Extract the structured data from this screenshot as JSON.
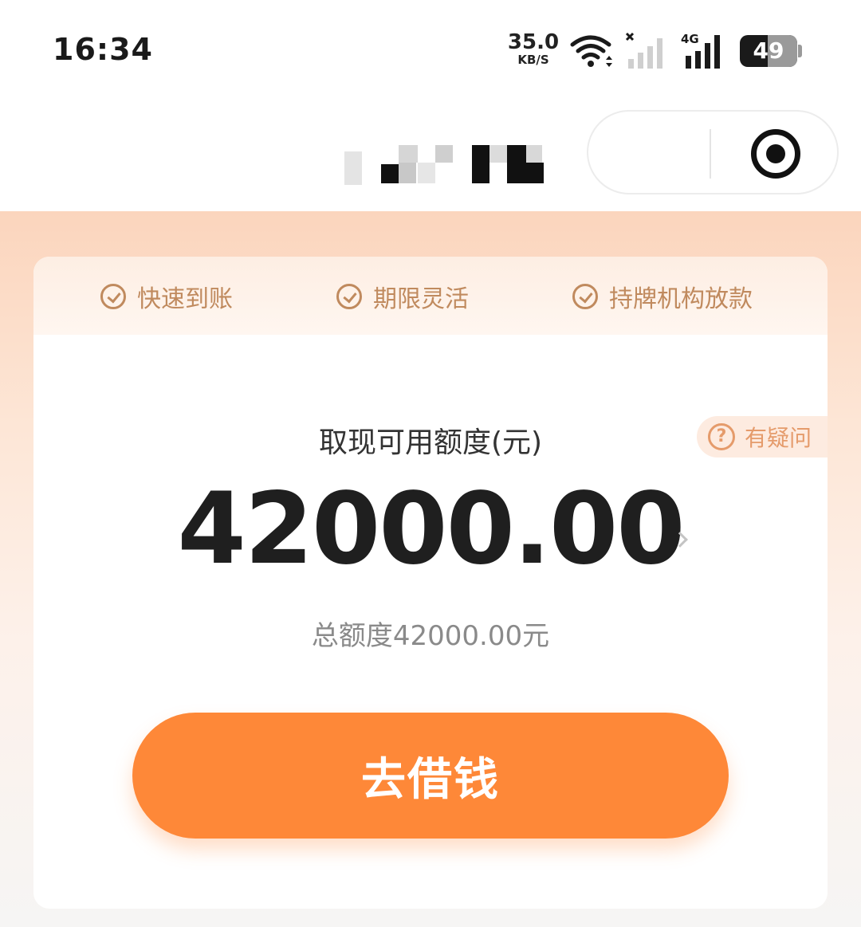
{
  "status_bar": {
    "time": "16:34",
    "net_speed_value": "35.0",
    "net_speed_unit": "KB/S",
    "sim2_network": "4G",
    "battery_level": "49",
    "battery_percent": 49
  },
  "header": {
    "title": "",
    "title_obscured": true,
    "capsule_icon": "record-target-icon"
  },
  "benefits": [
    {
      "icon": "check-circle-icon",
      "label": "快速到账"
    },
    {
      "icon": "check-circle-icon",
      "label": "期限灵活"
    },
    {
      "icon": "check-circle-icon",
      "label": "持牌机构放款"
    }
  ],
  "quota": {
    "label": "取现可用额度(元)",
    "help_icon": "?",
    "help_label": "有疑问",
    "amount": "42000.00",
    "total": "总额度42000.00元"
  },
  "action": {
    "borrow_label": "去借钱"
  },
  "colors": {
    "accent": "#fe8838",
    "benefit_text": "#c08a5e",
    "help_text": "#e59b6b",
    "page_top": "#fbd5bd"
  }
}
